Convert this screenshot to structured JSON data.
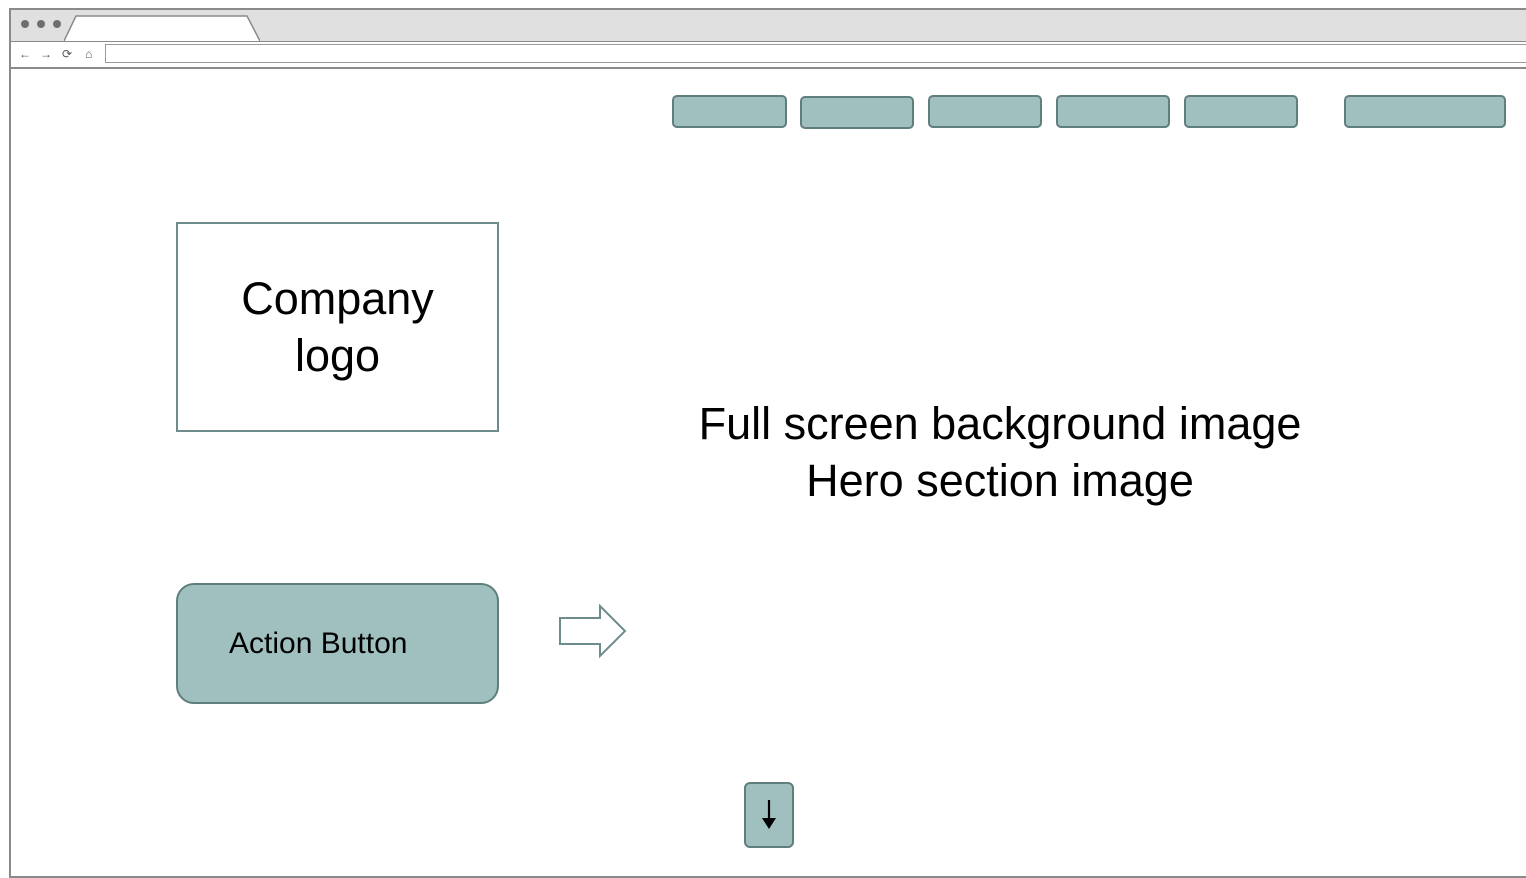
{
  "browser": {
    "window_controls": [
      "close",
      "minimize",
      "maximize"
    ],
    "nav_icons": [
      "back-icon",
      "forward-icon",
      "reload-icon",
      "home-icon"
    ],
    "url": ""
  },
  "nav": {
    "items": [
      "",
      "",
      "",
      "",
      "",
      ""
    ]
  },
  "logo": {
    "text": "Company\nlogo"
  },
  "hero": {
    "line1": "Full screen background image",
    "line2": "Hero section image"
  },
  "action_button": {
    "label": "Action Button"
  },
  "scroll_button": {
    "icon": "arrow-down-icon"
  },
  "colors": {
    "accent": "#9fc0bf",
    "border": "#5f7f7d",
    "chrome": "#e0e0e0"
  }
}
